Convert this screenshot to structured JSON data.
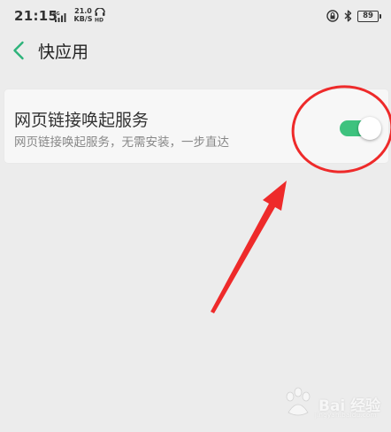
{
  "status_bar": {
    "time": "21:15",
    "network_badge": "4G",
    "net_speed_value": "21.0",
    "net_speed_unit": "KB/S",
    "hd_badge": "HD",
    "battery": "89"
  },
  "header": {
    "title": "快应用"
  },
  "setting": {
    "title": "网页链接唤起服务",
    "description": "网页链接唤起服务，无需安装，一步直达",
    "enabled": true
  },
  "watermark": {
    "text": "Bai 经验",
    "subtext": "jingyan.baidu.com"
  },
  "colors": {
    "toggle_on": "#3ec27e",
    "back_arrow": "#2db37a",
    "annotation": "#ee2a2a"
  },
  "icons": {
    "back": "chevron-left-icon",
    "signal": "signal-bars-icon",
    "hd": "hd-voice-icon",
    "lock": "rotation-lock-icon",
    "bluetooth": "bluetooth-icon",
    "battery": "battery-icon"
  }
}
